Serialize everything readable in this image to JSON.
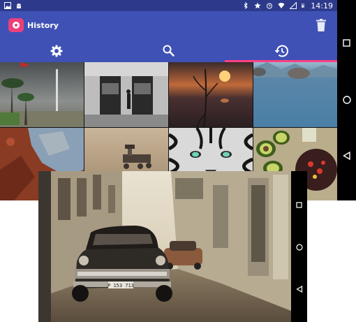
{
  "status_bar": {
    "time": "14:19",
    "icons": [
      "image-icon",
      "android-icon",
      "bluetooth-icon",
      "star-icon",
      "alarm-icon",
      "wifi-icon",
      "signal-icon",
      "battery-icon"
    ]
  },
  "app_bar": {
    "title": "History",
    "app_icon": "camera-icon",
    "action_icon": "trash-icon"
  },
  "tabs": [
    {
      "icon": "settings-icon",
      "active": false
    },
    {
      "icon": "search-icon",
      "active": false
    },
    {
      "icon": "history-icon",
      "active": true
    }
  ],
  "gallery": {
    "tiles": [
      "palm-plaza-photo",
      "doorway-bw-photo",
      "sunset-plant-photo",
      "blue-lake-rocks-photo",
      "rock-texture-photo",
      "mars-rover-photo",
      "tiger-bw-photo",
      "food-table-photo"
    ]
  },
  "overlay_photo": {
    "subject": "vintage-car-street-photo",
    "plate": "P 153 713"
  },
  "system_nav": [
    "recents-icon",
    "home-icon",
    "back-icon"
  ],
  "colors": {
    "primary": "#3f51b5",
    "primary_dark": "#2d3a8c",
    "accent": "#ff4081",
    "app_icon": "#ec407a"
  }
}
